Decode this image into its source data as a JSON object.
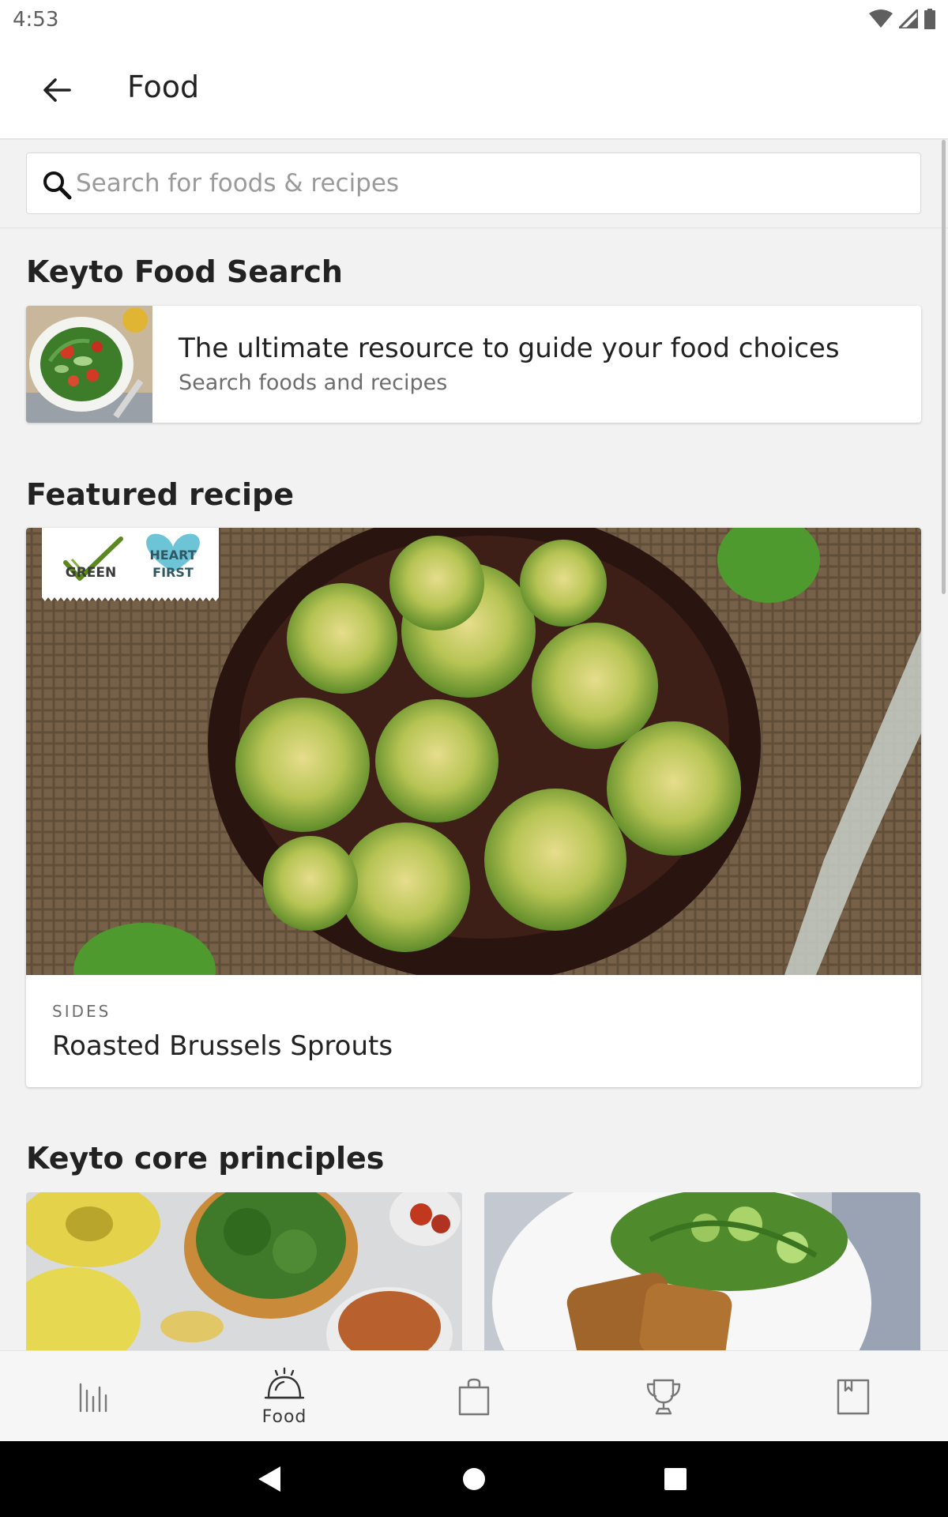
{
  "status_bar": {
    "time": "4:53",
    "icons": [
      "wifi-icon",
      "cell-signal-icon",
      "battery-icon"
    ]
  },
  "app_bar": {
    "back_icon": "arrow-back-icon",
    "title": "Food"
  },
  "search": {
    "icon": "search-icon",
    "placeholder": "Search for foods & recipes",
    "value": ""
  },
  "food_search_section": {
    "title": "Keyto Food Search",
    "card": {
      "headline": "The ultimate resource to guide your food choices",
      "subtitle": "Search foods and recipes"
    }
  },
  "featured_section": {
    "title": "Featured recipe",
    "recipe": {
      "badges": [
        {
          "label": "GREEN",
          "icon": "checkmark-icon",
          "color": "#5a8a1e"
        },
        {
          "label": "HEART FIRST",
          "icon": "heart-icon",
          "color": "#6cc4d6"
        }
      ],
      "category": "SIDES",
      "name": "Roasted Brussels Sprouts"
    }
  },
  "principles_section": {
    "title": "Keyto core principles"
  },
  "bottom_nav": {
    "items": [
      {
        "icon": "progress-bars-icon",
        "label": ""
      },
      {
        "icon": "cloche-icon",
        "label": "Food",
        "active": true
      },
      {
        "icon": "shopping-bag-icon",
        "label": ""
      },
      {
        "icon": "trophy-icon",
        "label": ""
      },
      {
        "icon": "bookmark-icon",
        "label": ""
      }
    ]
  },
  "system_nav": {
    "buttons": [
      "back-triangle-icon",
      "home-circle-icon",
      "recents-square-icon"
    ]
  },
  "colors": {
    "badge_green": "#5a8a1e",
    "badge_heart": "#6cc4d6",
    "background": "#f2f2f2"
  }
}
